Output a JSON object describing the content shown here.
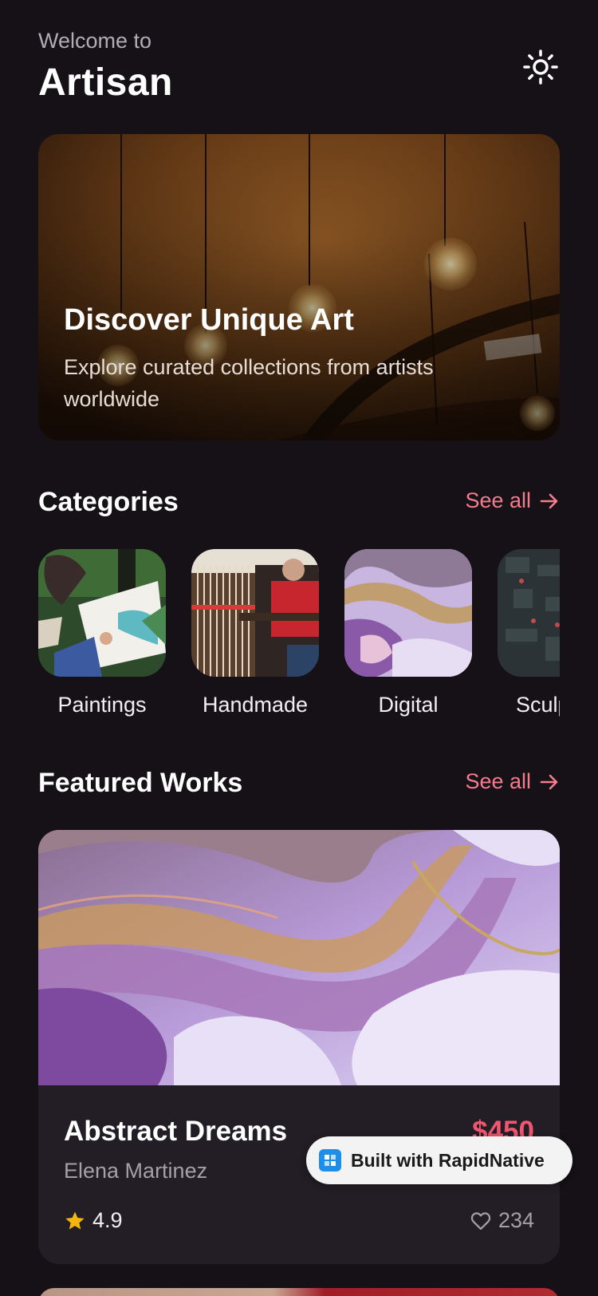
{
  "header": {
    "welcome": "Welcome to",
    "title": "Artisan",
    "theme_icon": "sun-icon"
  },
  "hero": {
    "title": "Discover Unique Art",
    "subtitle": "Explore curated collections from artists worldwide"
  },
  "categories": {
    "title": "Categories",
    "see_all": "See all",
    "items": [
      {
        "label": "Paintings"
      },
      {
        "label": "Handmade"
      },
      {
        "label": "Digital"
      },
      {
        "label": "Sculpture"
      }
    ]
  },
  "featured": {
    "title": "Featured Works",
    "see_all": "See all",
    "card": {
      "title": "Abstract Dreams",
      "artist": "Elena Martinez",
      "price": "$450",
      "rating": "4.9",
      "likes": "234"
    }
  },
  "badge": {
    "label": "Built with RapidNative"
  },
  "colors": {
    "background": "#151117",
    "accent": "#f47c8d",
    "price": "#f0566f",
    "star": "#f5b50f",
    "card": "#231e26"
  }
}
